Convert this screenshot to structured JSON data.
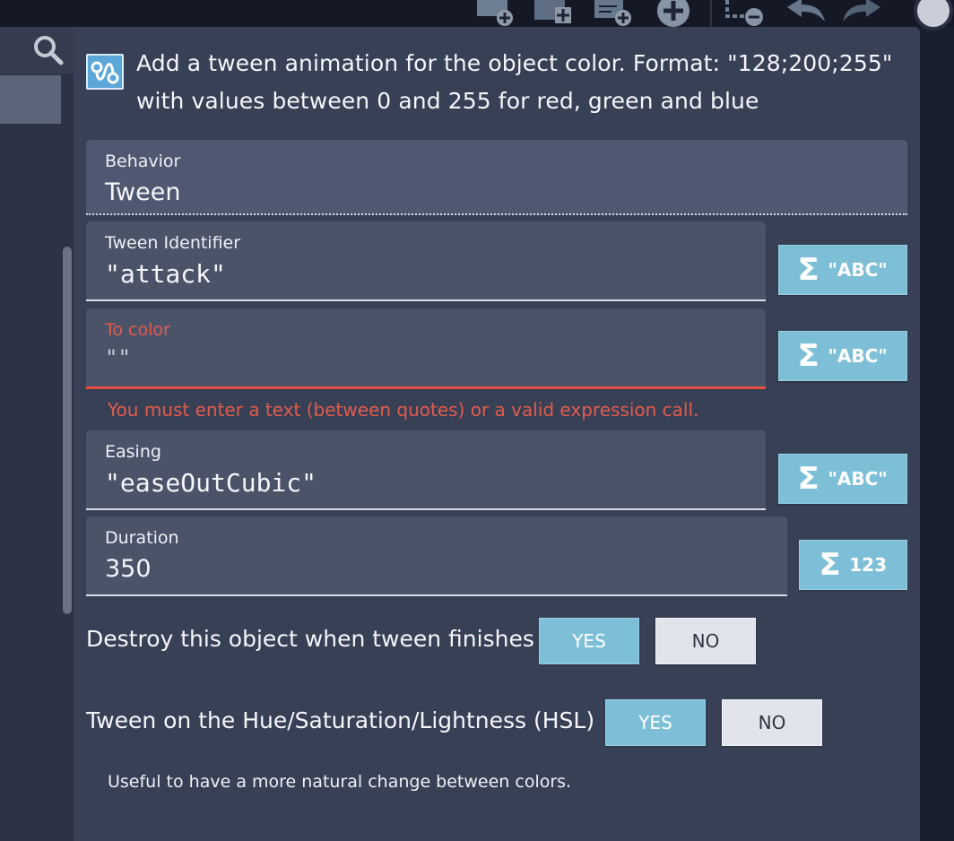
{
  "toolbar": {
    "icons": [
      "add-scene-icon",
      "add-object-icon",
      "add-resource-icon",
      "add-circle-icon",
      "remove-item-icon",
      "undo-icon",
      "redo-icon"
    ]
  },
  "sidebar": {
    "search_icon": "search-icon"
  },
  "dialog": {
    "header": {
      "icon": "tween-curve-icon",
      "text": "Add a tween animation for the object color. Format: \"128;200;255\" with values between 0 and 255 for red, green and blue"
    },
    "behavior": {
      "label": "Behavior",
      "value": "Tween"
    },
    "tween_identifier": {
      "label": "Tween Identifier",
      "value": "\"attack\"",
      "button_sigma": "Σ",
      "button_kind": "\"ABC\""
    },
    "to_color": {
      "label": "To color",
      "value": "\"\"",
      "error": "You must enter a text (between quotes) or a valid expression call.",
      "button_sigma": "Σ",
      "button_kind": "\"ABC\""
    },
    "easing": {
      "label": "Easing",
      "value": "\"easeOutCubic\"",
      "button_sigma": "Σ",
      "button_kind": "\"ABC\""
    },
    "duration": {
      "label": "Duration",
      "value": "350",
      "button_sigma": "Σ",
      "button_kind": "123"
    },
    "destroy": {
      "label": "Destroy this object when tween finishes",
      "yes": "YES",
      "no": "NO",
      "selected": "YES"
    },
    "hsl": {
      "label": "Tween on the Hue/Saturation/Lightness (HSL)",
      "yes": "YES",
      "no": "NO",
      "selected": "YES",
      "help": "Useful to have a more natural change between colors."
    }
  },
  "colors": {
    "background": "#181c2a",
    "dialog": "#384055",
    "field": "#4b5369",
    "accent": "#7ebfd8",
    "error": "#e15b4d"
  }
}
